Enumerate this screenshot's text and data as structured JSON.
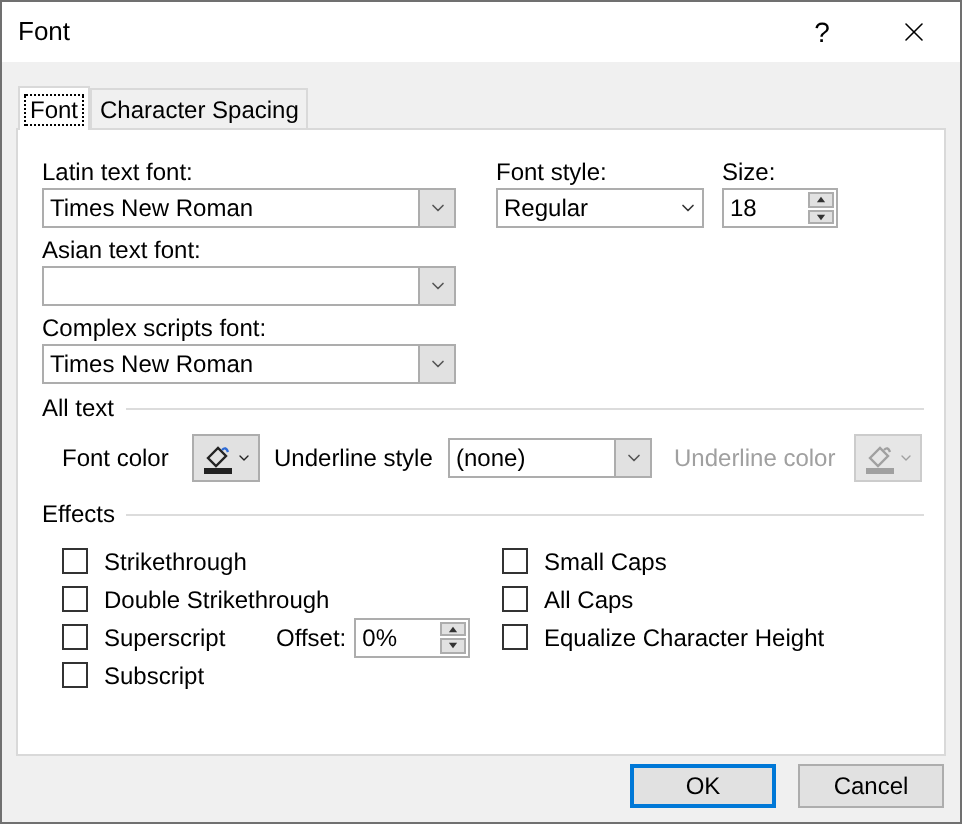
{
  "window": {
    "title": "Font",
    "help": "?"
  },
  "tabs": [
    {
      "label": "Font",
      "selected": true
    },
    {
      "label": "Character Spacing",
      "selected": false
    }
  ],
  "fonts": {
    "latin": {
      "label": "Latin text font:",
      "value": "Times New Roman"
    },
    "style": {
      "label": "Font style:",
      "value": "Regular"
    },
    "size": {
      "label": "Size:",
      "value": "18"
    },
    "asian": {
      "label": "Asian text font:"
    },
    "complex": {
      "label": "Complex scripts font:",
      "value": "Times New Roman"
    }
  },
  "all_text": {
    "heading": "All text",
    "font_color": {
      "label": "Font color",
      "disabled": false
    },
    "underline_style": {
      "label": "Underline style",
      "value": "(none)"
    },
    "underline_color": {
      "label": "Underline color",
      "disabled": true
    }
  },
  "effects": {
    "heading": "Effects",
    "offset": {
      "label": "Offset:",
      "value": "0%"
    },
    "left": [
      {
        "label": "Strikethrough",
        "checked": false
      },
      {
        "label": "Double Strikethrough",
        "checked": false
      },
      {
        "label": "Superscript",
        "checked": false
      },
      {
        "label": "Subscript",
        "checked": false
      }
    ],
    "right": [
      {
        "label": "Small Caps",
        "checked": false
      },
      {
        "label": "All Caps",
        "checked": false
      },
      {
        "label": "Equalize Character Height",
        "checked": false
      }
    ]
  },
  "buttons": [
    {
      "label": "OK",
      "default": true
    },
    {
      "label": "Cancel",
      "default": false
    }
  ]
}
